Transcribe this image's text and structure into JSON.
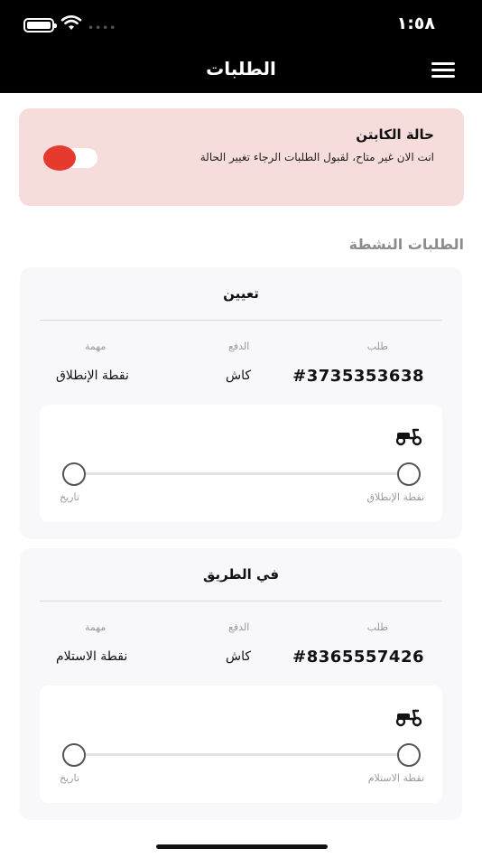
{
  "status_bar": {
    "time": "١:٥٨"
  },
  "header": {
    "title": "الطلبات",
    "menu_icon": "hamburger-icon"
  },
  "captain": {
    "title": "حالة الكابتن",
    "subtitle": "انت الان غير متاح، لقبول الطلبات الرجاء تغيير الحالة",
    "available": false,
    "toggle_color": "#e63a2e"
  },
  "active_orders": {
    "title": "الطلبات النشطة",
    "orders": [
      {
        "status": "تعيين",
        "order_label": "طلب",
        "order_number": "#3735353638",
        "payment_label": "الدفع",
        "payment_value": "كاش",
        "task_label": "مهمة",
        "task_value": "نقطة الإنطلاق",
        "route_from": "نقطة الإنطلاق",
        "route_to": "تاريخ"
      },
      {
        "status": "في الطريق",
        "order_label": "طلب",
        "order_number": "#8365557426",
        "payment_label": "الدفع",
        "payment_value": "كاش",
        "task_label": "مهمة",
        "task_value": "نقطة الاستلام",
        "route_from": "نقطة الاستلام",
        "route_to": "تاريخ"
      }
    ]
  },
  "colors": {
    "header_bg": "#000000",
    "captain_card_bg": "#f7dcdc",
    "accent_red": "#e63a2e"
  }
}
